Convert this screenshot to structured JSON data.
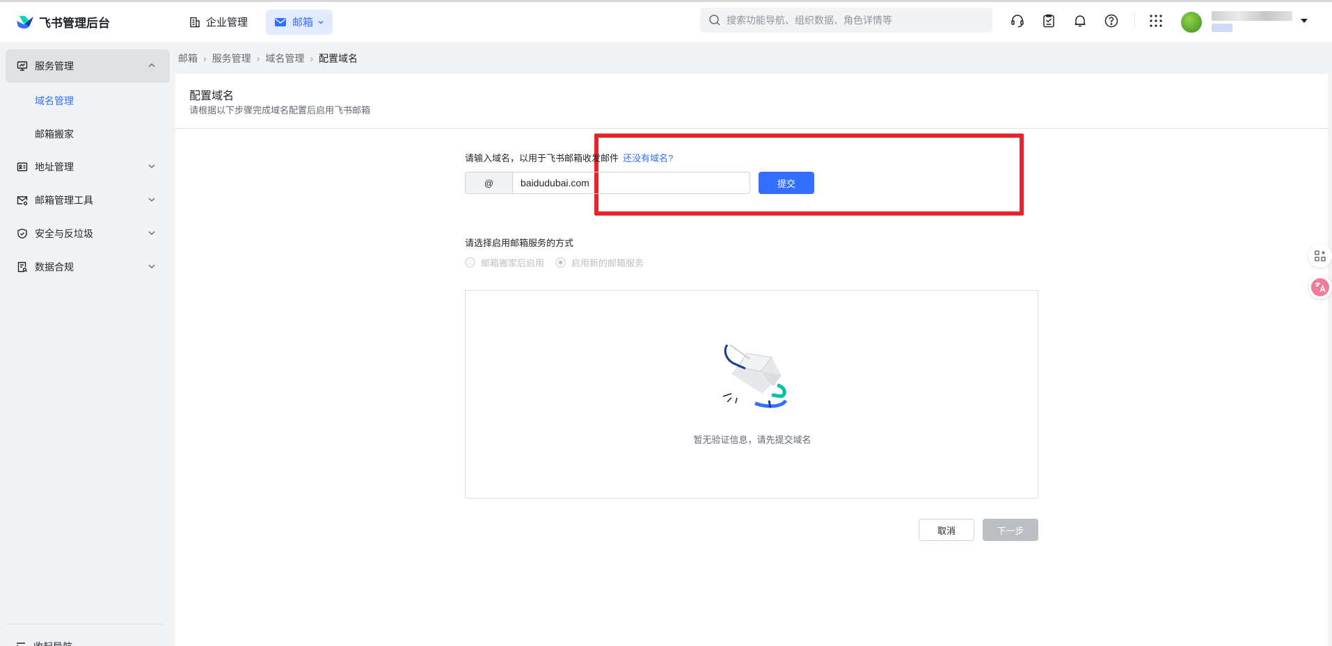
{
  "app": {
    "title": "飞书管理后台",
    "nav": {
      "enterprise": "企业管理",
      "mail": "邮箱"
    },
    "search_placeholder": "搜索功能导航、组织数据、角色详情等"
  },
  "sidebar": {
    "service_mgmt": "服务管理",
    "domain_mgmt": "域名管理",
    "mailbox_migration": "邮箱搬家",
    "address_mgmt": "地址管理",
    "mail_tools": "邮箱管理工具",
    "security": "安全与反垃圾",
    "compliance": "数据合规",
    "collapse": "收起导航"
  },
  "breadcrumb": [
    "邮箱",
    "服务管理",
    "域名管理",
    "配置域名"
  ],
  "page": {
    "title": "配置域名",
    "subtitle": "请根据以下步骤完成域名配置后启用飞书邮箱",
    "domain_prompt": "请输入域名，以用于飞书邮箱收发邮件",
    "no_domain_link": "还没有域名?",
    "at_prefix": "@",
    "domain_value": "baidudubai.com",
    "submit": "提交",
    "method_label": "请选择启用邮箱服务的方式",
    "option_migrate": "邮箱搬家后启用",
    "option_new": "启用新的邮箱服务",
    "empty_text": "暂无验证信息，请先提交域名",
    "cancel": "取消",
    "next": "下一步"
  },
  "colors": {
    "accent": "#3370ff",
    "highlight": "#e8232c",
    "disabled": "#bbbfc4"
  },
  "icons": [
    "feishu-logo-icon",
    "building-icon",
    "mail-icon",
    "chevron-down-icon",
    "search-icon",
    "headset-icon",
    "clipboard-icon",
    "bell-icon",
    "help-icon",
    "apps-grid-icon",
    "monitor-icon",
    "contact-card-icon",
    "mail-settings-icon",
    "shield-icon",
    "document-data-icon",
    "collapse-nav-icon",
    "app-directory-icon",
    "translate-icon"
  ]
}
